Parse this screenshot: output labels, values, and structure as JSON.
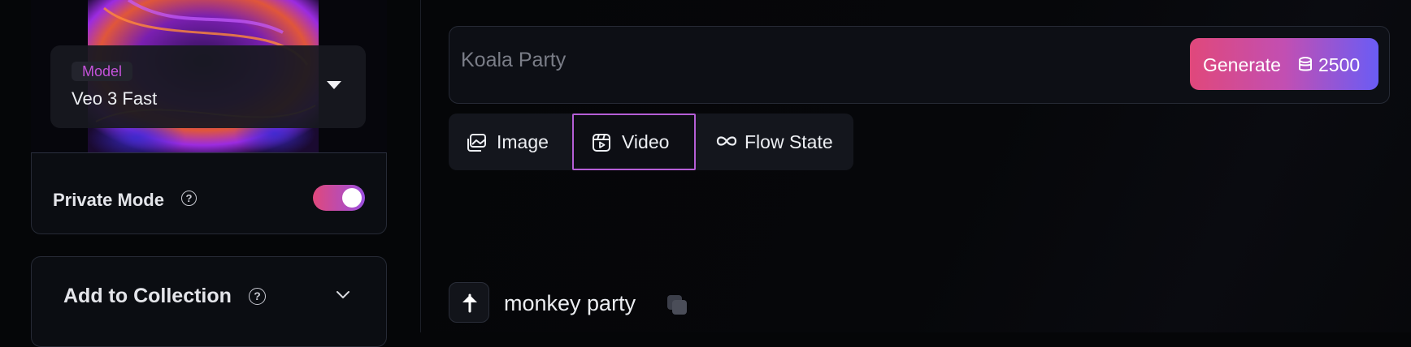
{
  "sidebar": {
    "model": {
      "badge": "Model",
      "value": "Veo 3 Fast"
    },
    "private_mode": {
      "label": "Private Mode",
      "help": "?",
      "enabled": true
    },
    "collection": {
      "label": "Add to Collection",
      "help": "?"
    }
  },
  "prompt": {
    "placeholder": "Koala Party",
    "generate_label": "Generate",
    "cost": "2500"
  },
  "modes": {
    "tabs": [
      {
        "label": "Image",
        "icon": "image-icon"
      },
      {
        "label": "Video",
        "icon": "video-icon"
      },
      {
        "label": "Flow State",
        "icon": "infinity-icon"
      }
    ],
    "selected": "Video"
  },
  "history": {
    "text": "monkey party"
  },
  "colors": {
    "accent_pink": "#e0487b",
    "accent_purple": "#c452d9",
    "accent_blue": "#6a5cf5",
    "background": "#050608",
    "panel": "#0b0d12"
  }
}
